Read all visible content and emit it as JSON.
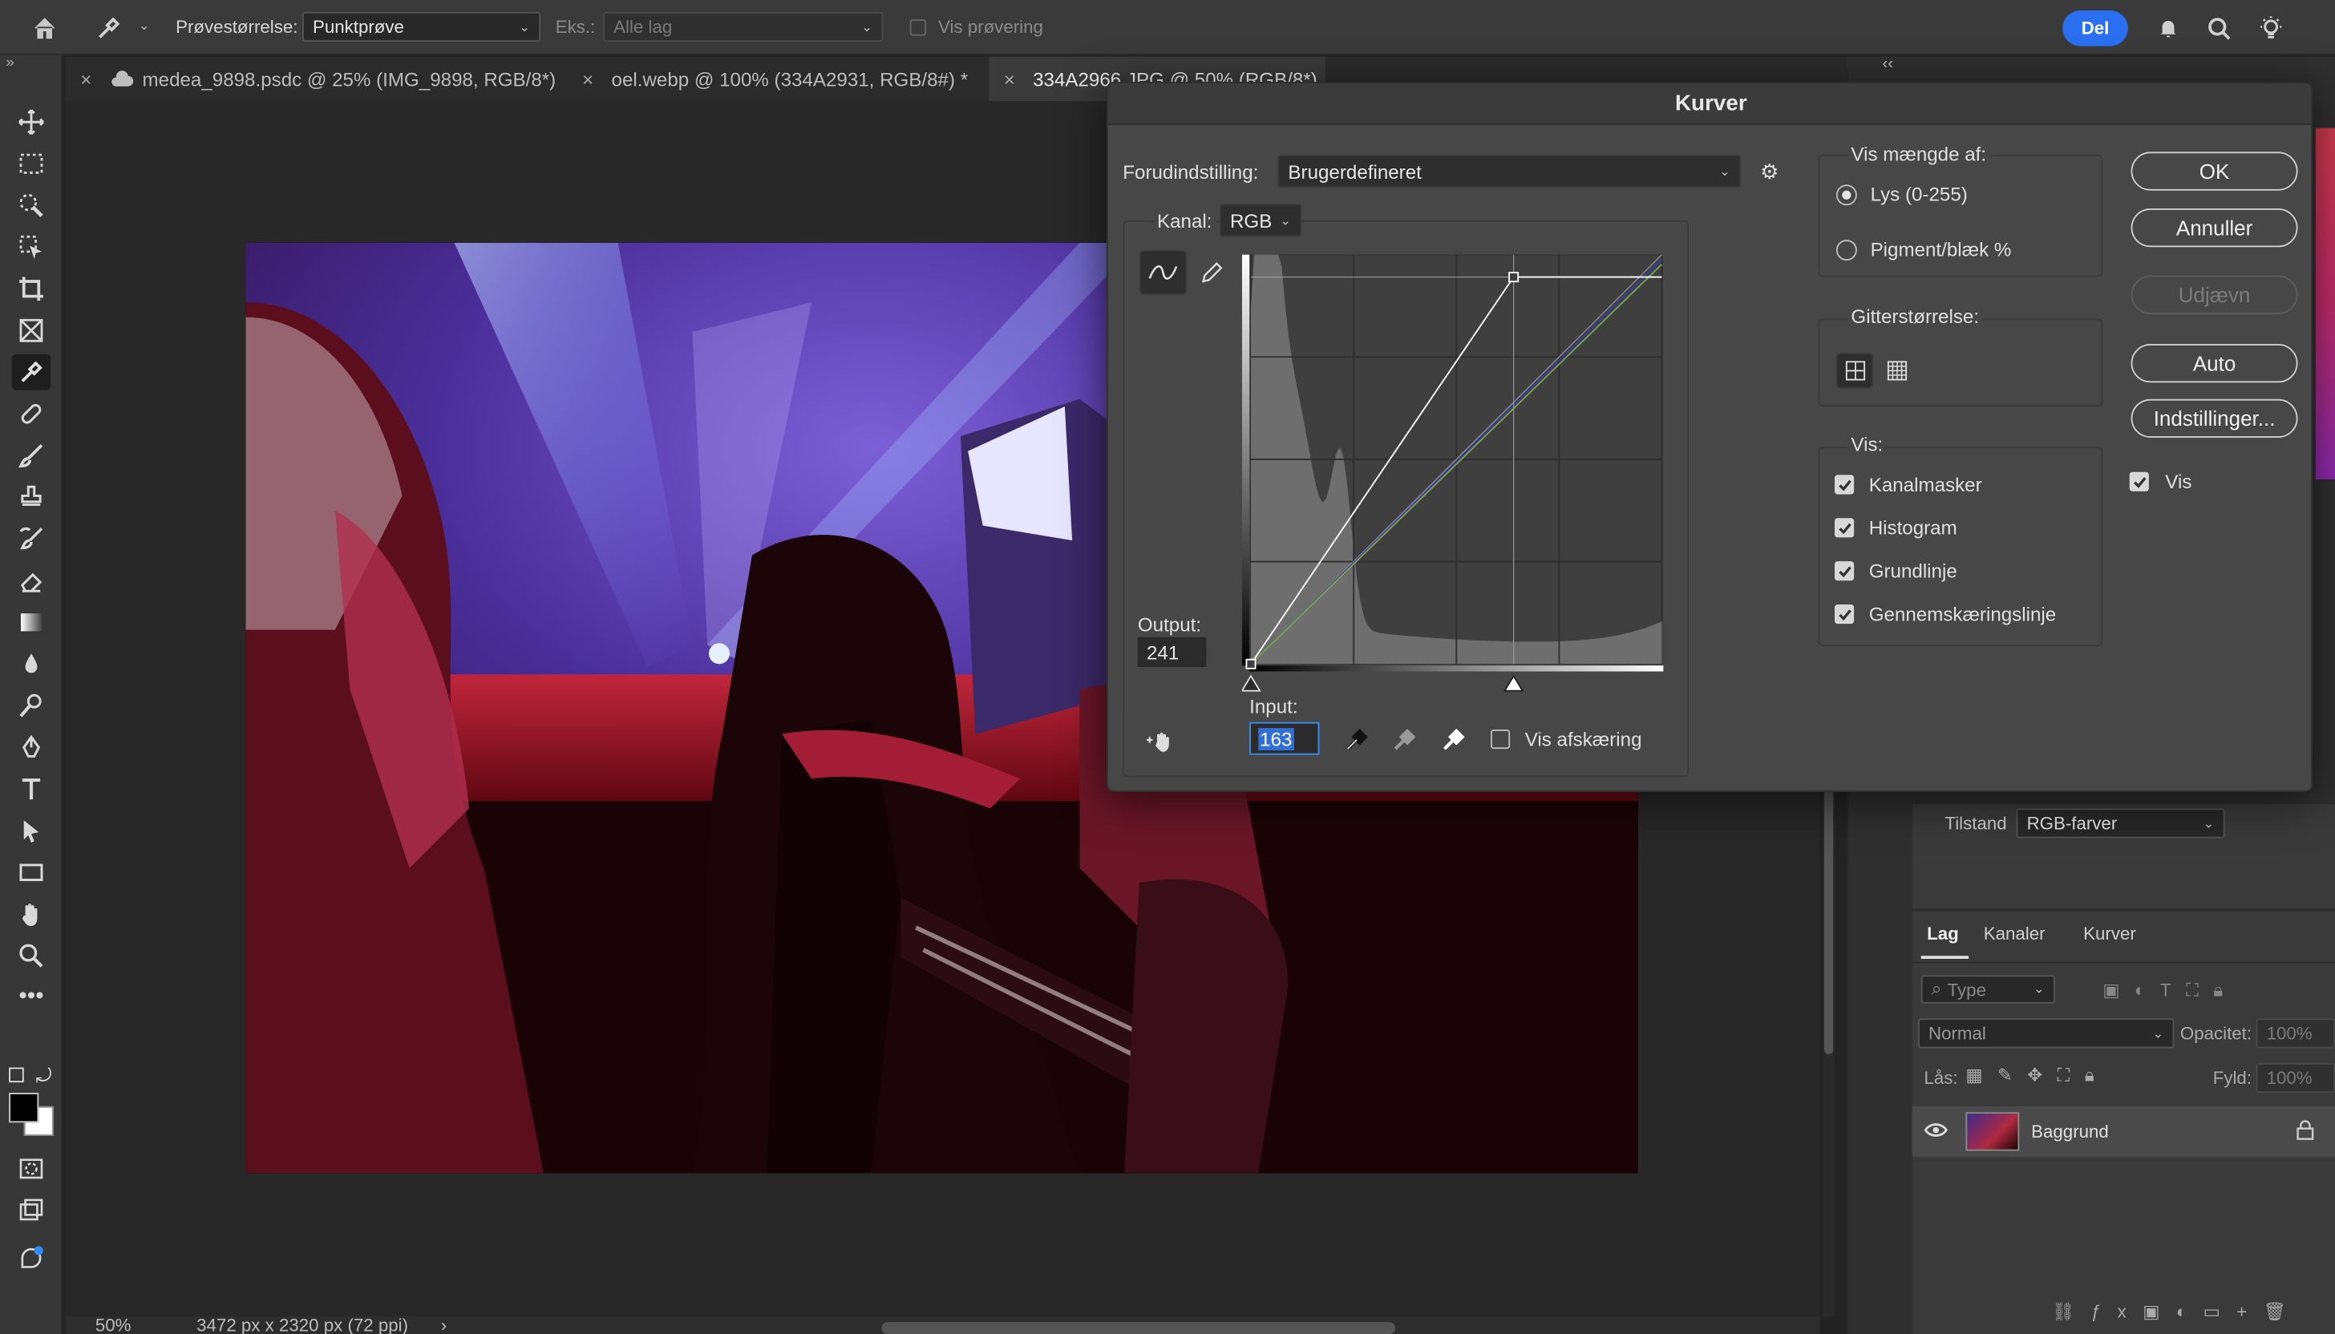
{
  "options_bar": {
    "sample_size_label": "Prøvestørrelse:",
    "sample_size_value": "Punktprøve",
    "sample_label": "Eks.:",
    "sample_value": "Alle lag",
    "show_ring_label": "Vis prøvering",
    "share_label": "Del"
  },
  "tabs": [
    {
      "label": "medea_9898.psdc @ 25% (IMG_9898, RGB/8*)"
    },
    {
      "label": "oel.webp @ 100% (334A2931, RGB/8#) *"
    },
    {
      "label": "334A2966.JPG @ 50% (RGB/8*)"
    }
  ],
  "status": {
    "zoom": "50%",
    "doc_size": "3472 px x 2320 px (72 ppi)"
  },
  "properties": {
    "mode_label": "Tilstand",
    "mode_value": "RGB-farver"
  },
  "layers_panel": {
    "tabs": [
      "Lag",
      "Kanaler",
      "Kurver"
    ],
    "filter_placeholder": "Type",
    "blend_mode": "Normal",
    "opacity_label": "Opacitet:",
    "opacity_value": "100%",
    "lock_label": "Lås:",
    "fill_label": "Fyld:",
    "fill_value": "100%",
    "layer_name": "Baggrund"
  },
  "dialog": {
    "title": "Kurver",
    "preset_label": "Forudindstilling:",
    "preset_value": "Brugerdefineret",
    "channel_label": "Kanal:",
    "channel_value": "RGB",
    "output_label": "Output:",
    "output_value": "241",
    "input_label": "Input:",
    "input_value": "163",
    "show_clipping_label": "Vis afskæring",
    "show_amount_title": "Vis mængde af:",
    "amount_light": "Lys (0-255)",
    "amount_pigment": "Pigment/blæk %",
    "amount_selected": "light",
    "grid_size_title": "Gitterstørrelse:",
    "show_title": "Vis:",
    "show_options": [
      {
        "label": "Kanalmasker",
        "checked": true
      },
      {
        "label": "Histogram",
        "checked": true
      },
      {
        "label": "Grundlinje",
        "checked": true
      },
      {
        "label": "Gennemskæringslinje",
        "checked": true
      }
    ],
    "buttons": {
      "ok": "OK",
      "cancel": "Annuller",
      "smooth": "Udjævn",
      "auto": "Auto",
      "options": "Indstillinger..."
    },
    "preview_label": "Vis",
    "preview_checked": true,
    "curve_points": [
      {
        "input": 0,
        "output": 0
      },
      {
        "input": 163,
        "output": 241
      },
      {
        "input": 255,
        "output": 241
      }
    ],
    "black_point_input": 0,
    "white_point_input": 163
  }
}
